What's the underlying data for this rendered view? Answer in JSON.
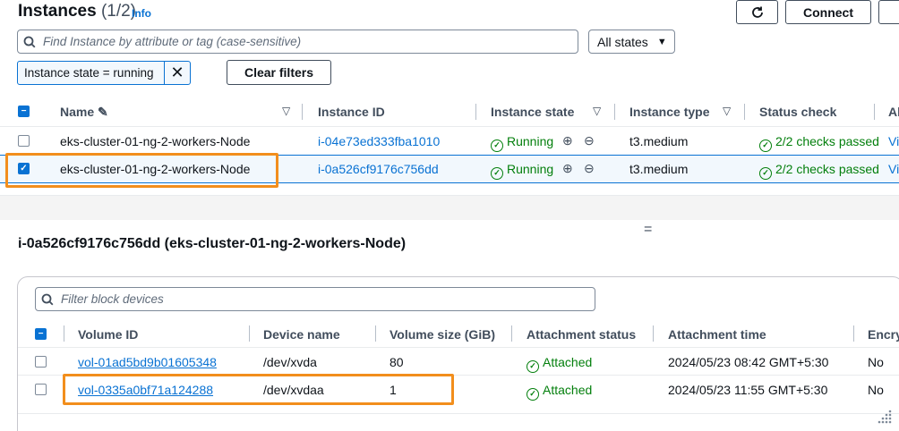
{
  "header": {
    "title": "Instances",
    "count": "(1/2)",
    "info_label": "Info",
    "refresh_icon": "refresh-icon",
    "connect_label": "Connect"
  },
  "search": {
    "placeholder": "Find Instance by attribute or tag (case-sensitive)",
    "states_select": "All states"
  },
  "filter_token": {
    "label": "Instance state = running",
    "clear_label": "Clear filters"
  },
  "instances_table": {
    "columns": [
      "Name",
      "Instance ID",
      "Instance state",
      "Instance type",
      "Status check",
      "Al"
    ],
    "rows": [
      {
        "name": "eks-cluster-01-ng-2-workers-Node",
        "instance_id": "i-04e73ed333fba1010",
        "state": "Running",
        "type": "t3.medium",
        "status": "2/2 checks passed",
        "alarm": "Vi",
        "selected": false
      },
      {
        "name": "eks-cluster-01-ng-2-workers-Node",
        "instance_id": "i-0a526cf9176c756dd",
        "state": "Running",
        "type": "t3.medium",
        "status": "2/2 checks passed",
        "alarm": "Vi",
        "selected": true
      }
    ]
  },
  "detail": {
    "title": "i-0a526cf9176c756dd (eks-cluster-01-ng-2-workers-Node)",
    "filter_placeholder": "Filter block devices",
    "columns": [
      "Volume ID",
      "Device name",
      "Volume size (GiB)",
      "Attachment status",
      "Attachment time",
      "Encry"
    ],
    "rows": [
      {
        "volume_id": "vol-01ad5bd9b01605348",
        "device": "/dev/xvda",
        "size": "80",
        "status": "Attached",
        "time": "2024/05/23 08:42 GMT+5:30",
        "enc": "No"
      },
      {
        "volume_id": "vol-0335a0bf71a124288",
        "device": "/dev/xvdaa",
        "size": "1",
        "status": "Attached",
        "time": "2024/05/23 11:55 GMT+5:30",
        "enc": "No"
      }
    ]
  },
  "colors": {
    "accent": "#0972d3",
    "success": "#037f0c",
    "highlight": "#f28e1c"
  }
}
